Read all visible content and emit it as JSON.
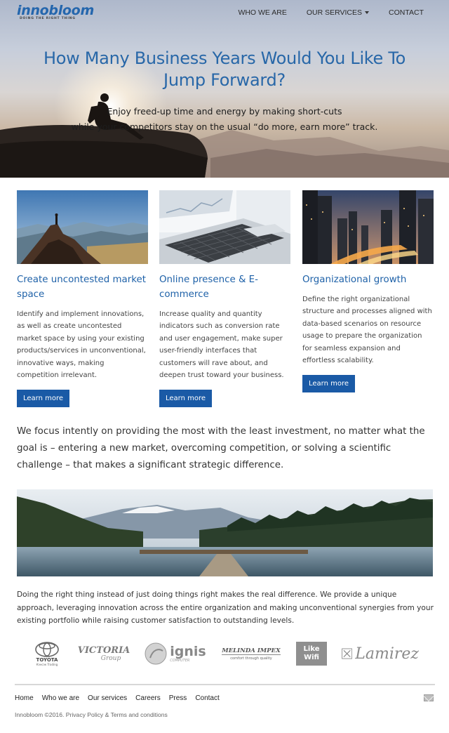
{
  "brand": {
    "logo_text": "innobloom",
    "tagline": "DOING THE RIGHT THING",
    "colors": {
      "primary": "#1a5aa6",
      "heading": "#2867a8"
    }
  },
  "nav": {
    "items": [
      {
        "label": "WHO WE ARE"
      },
      {
        "label": "OUR SERVICES",
        "dropdown": true
      },
      {
        "label": "CONTACT"
      }
    ]
  },
  "hero": {
    "title_line1": "How Many Business Years Would You Like To",
    "title_line2": "Jump Forward?",
    "subtitle_line1": "Enjoy freed-up time and energy by making short-cuts",
    "subtitle_line2": "while your competitors stay on the usual “do more, earn more” track."
  },
  "cards": [
    {
      "image": "mountain-climber-photo",
      "title": "Create uncontested market space",
      "text": "Identify and implement innovations, as well as create uncontested market space by using your existing products/services in unconventional, innovative ways, making competition irrelevant.",
      "button": "Learn more"
    },
    {
      "image": "laptop-photo",
      "title": "Online presence & E-commerce",
      "text": "Increase quality and quantity indicators such as conversion rate and user engagement, make super user-friendly interfaces that customers will rave about, and deepen trust toward your business.",
      "button": "Learn more"
    },
    {
      "image": "city-night-photo",
      "title": "Organizational growth",
      "text": "Define the right organizational structure and processes aligned with data-based scenarios on resource usage to prepare the organization for seamless expansion and effortless scalability.",
      "button": "Learn more"
    }
  ],
  "focus_text": "We focus intently on providing the most with the least investment, no matter what the goal is – entering a new market, overcoming competition, or solving a scientific challenge – that makes a significant strategic difference.",
  "lake_image": "lake-pier-photo",
  "about_text": "Doing the right thing instead of just doing things right makes the real difference. We provide a unique approach, leveraging innovation across the entire organization and making unconventional synergies from your existing portfolio while raising customer satisfaction to outstanding levels.",
  "clients": [
    {
      "name": "TOYOTA",
      "sub": "Кэнсэк Trading"
    },
    {
      "name": "VICTORIA",
      "sub": "Group"
    },
    {
      "name": "ignis",
      "sub": "COMPUTER"
    },
    {
      "name": "MELINDA IMPEX",
      "sub": "comfort through quality"
    },
    {
      "name": "Like Wifi"
    },
    {
      "name": "Lamirez"
    }
  ],
  "footer": {
    "links": [
      "Home",
      "Who we are",
      "Our services",
      "Careers",
      "Press",
      "Contact"
    ],
    "copyright": "Innobloom ©2016. Privacy Policy & Terms and conditions"
  }
}
